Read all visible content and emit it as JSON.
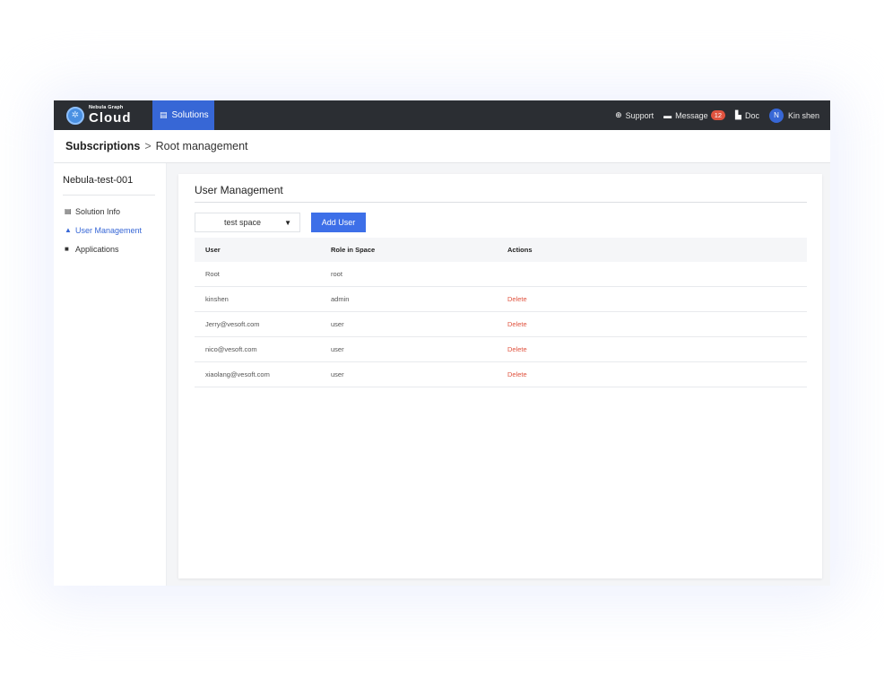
{
  "brand": {
    "small": "Nebula Graph",
    "big": "Cloud"
  },
  "topbar": {
    "solutions_label": "Solutions",
    "support_label": "Support",
    "message_label": "Message",
    "message_count": "12",
    "doc_label": "Doc",
    "user_initial": "N",
    "user_name": "Kin shen"
  },
  "breadcrumb": {
    "first": "Subscriptions",
    "separator": ">",
    "second": "Root management"
  },
  "sidebar": {
    "cluster": "Nebula-test-001",
    "items": [
      {
        "label": "Solution Info",
        "icon": "document-icon",
        "active": false
      },
      {
        "label": "User Management",
        "icon": "user-icon",
        "active": true
      },
      {
        "label": "Applications",
        "icon": "apps-grid-icon",
        "active": false
      }
    ]
  },
  "main": {
    "title": "User Management",
    "space_select": "test space",
    "add_user_label": "Add User",
    "columns": [
      "User",
      "Role in Space",
      "Actions"
    ],
    "rows": [
      {
        "user": "Root",
        "role": "root",
        "action": ""
      },
      {
        "user": "kinshen",
        "role": "admin",
        "action": "Delete"
      },
      {
        "user": "Jerry@vesoft.com",
        "role": "user",
        "action": "Delete"
      },
      {
        "user": "nico@vesoft.com",
        "role": "user",
        "action": "Delete"
      },
      {
        "user": "xiaolang@vesoft.com",
        "role": "user",
        "action": "Delete"
      }
    ]
  },
  "colors": {
    "topbar": "#2b2e33",
    "accent": "#3767d6",
    "danger": "#e0533f"
  }
}
